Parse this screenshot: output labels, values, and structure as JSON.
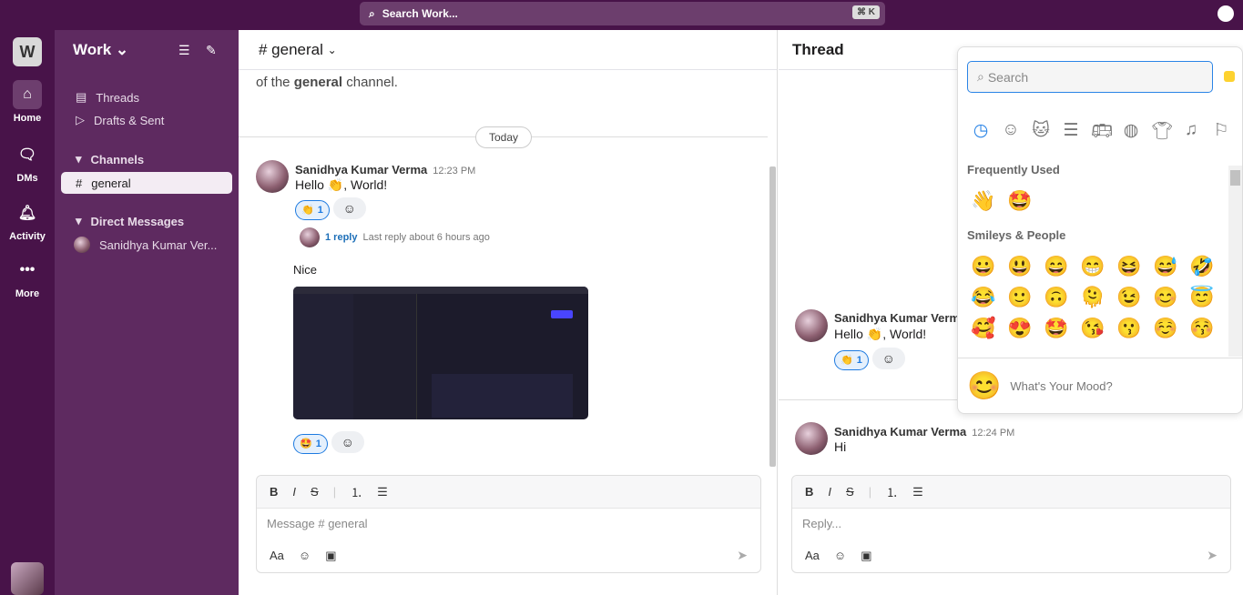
{
  "topbar": {
    "search_placeholder": "Search Work...",
    "shortcut": "⌘ K"
  },
  "rail": {
    "workspace_initial": "W",
    "items": [
      {
        "label": "Home",
        "icon": "home-icon"
      },
      {
        "label": "DMs",
        "icon": "chat-icon"
      },
      {
        "label": "Activity",
        "icon": "bell-icon"
      },
      {
        "label": "More",
        "icon": "more-icon"
      }
    ]
  },
  "sidebar": {
    "workspace": "Work",
    "threads": "Threads",
    "drafts": "Drafts & Sent",
    "channels_label": "Channels",
    "channel": "general",
    "dm_label": "Direct Messages",
    "dm_user": "Sanidhya Kumar Ver..."
  },
  "channel": {
    "title": "# general",
    "intro_prefix": "of the ",
    "intro_bold": "general",
    "intro_suffix": " channel.",
    "date_divider": "Today",
    "messages": [
      {
        "author": "Sanidhya Kumar Verma",
        "time": "12:23 PM",
        "text": "Hello 👏, World!",
        "reaction": "👏",
        "reaction_count": "1",
        "replies": "1 reply",
        "last_reply": "Last reply about 6 hours ago"
      },
      {
        "text": "Nice",
        "reaction": "🤩",
        "reaction_count": "1"
      }
    ],
    "composer_placeholder": "Message # general"
  },
  "thread": {
    "title": "Thread",
    "messages": [
      {
        "author": "Sanidhya Kumar Verma",
        "text": "Hello 👏, World!",
        "reaction": "👏",
        "reaction_count": "1"
      },
      {
        "author": "Sanidhya Kumar Verma",
        "time": "12:24 PM",
        "text": "Hi"
      }
    ],
    "composer_placeholder": "Reply..."
  },
  "picker": {
    "search_placeholder": "Search",
    "tone_color": "#fdd22f",
    "frequent_label": "Frequently Used",
    "frequent": [
      "👋",
      "🤩"
    ],
    "smileys_label": "Smileys & People",
    "smileys": [
      "😀",
      "😃",
      "😄",
      "😁",
      "😆",
      "😅",
      "🤣",
      "😂",
      "🙂",
      "🙃",
      "🫠",
      "😉",
      "😊",
      "😇",
      "🥰",
      "😍",
      "🤩",
      "😘",
      "😗",
      "☺️",
      "😚"
    ],
    "mood_emoji": "😊",
    "mood": "What's Your Mood?"
  }
}
